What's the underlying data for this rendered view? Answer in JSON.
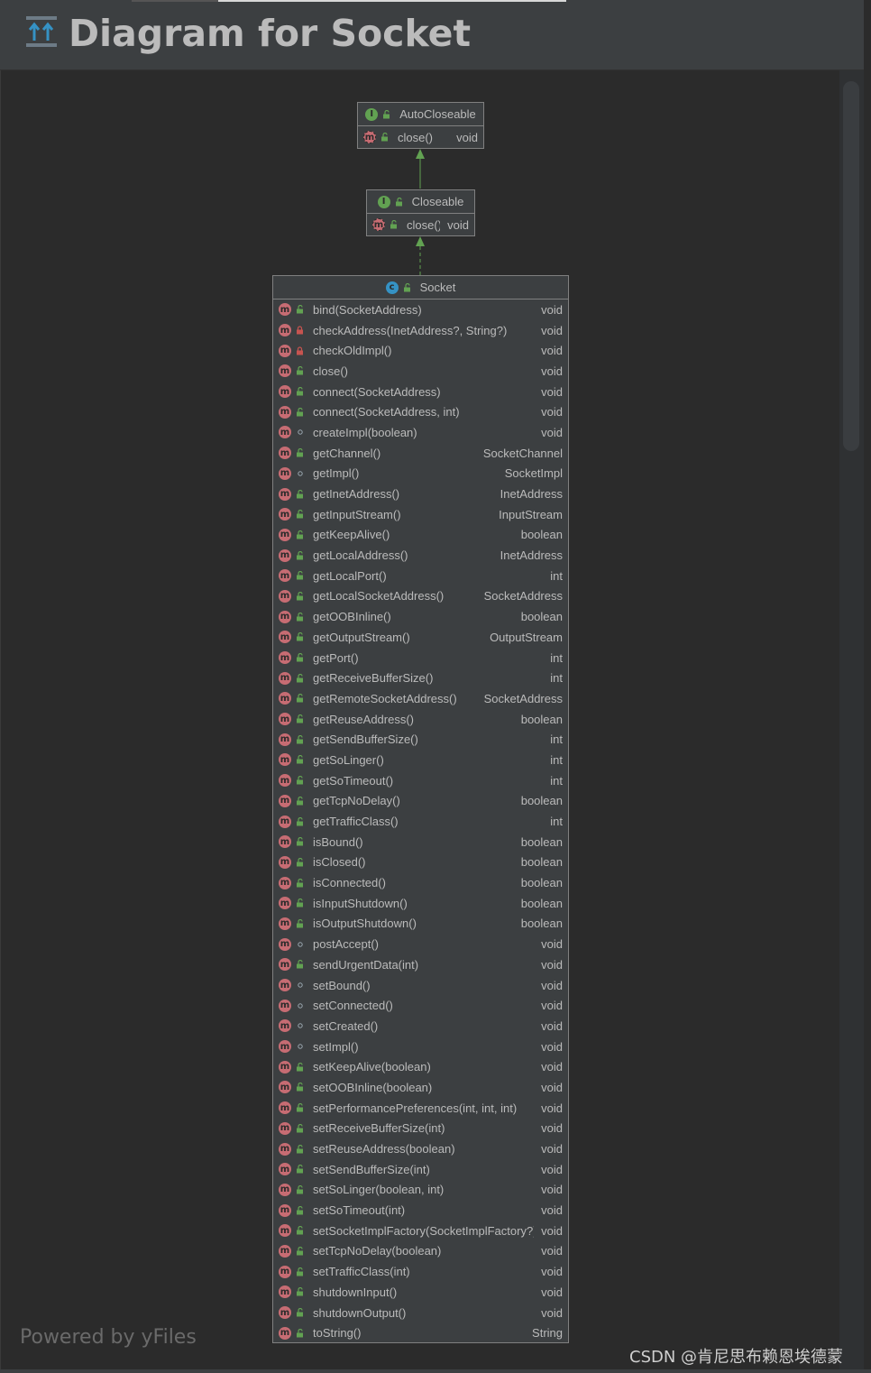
{
  "title": "Diagram for Socket",
  "footer": {
    "powered_by": "Powered by yFiles",
    "watermark": "CSDN @肯尼思布赖恩埃德蒙"
  },
  "colors": {
    "background": "#2b2b2b",
    "node_fill": "#3c3f41",
    "node_border": "#808080",
    "method_badge": "#c76c73",
    "interface_badge": "#62a252",
    "class_badge": "#3592c4",
    "public_lock": "#62a252",
    "private_lock": "#c75450",
    "arrow": "#62a252"
  },
  "nodes": {
    "autocloseable": {
      "name": "AutoCloseable",
      "kind": "interface",
      "methods": [
        {
          "name": "close()",
          "type": "void",
          "visibility": "public",
          "abstract": true
        }
      ]
    },
    "closeable": {
      "name": "Closeable",
      "kind": "interface",
      "methods": [
        {
          "name": "close()",
          "type": "void",
          "visibility": "public",
          "abstract": true
        }
      ]
    },
    "socket": {
      "name": "Socket",
      "kind": "class",
      "methods": [
        {
          "name": "bind(SocketAddress)",
          "type": "void",
          "visibility": "public"
        },
        {
          "name": "checkAddress(InetAddress?, String?)",
          "type": "void",
          "visibility": "private"
        },
        {
          "name": "checkOldImpl()",
          "type": "void",
          "visibility": "private"
        },
        {
          "name": "close()",
          "type": "void",
          "visibility": "public"
        },
        {
          "name": "connect(SocketAddress)",
          "type": "void",
          "visibility": "public"
        },
        {
          "name": "connect(SocketAddress, int)",
          "type": "void",
          "visibility": "public"
        },
        {
          "name": "createImpl(boolean)",
          "type": "void",
          "visibility": "package"
        },
        {
          "name": "getChannel()",
          "type": "SocketChannel",
          "visibility": "public"
        },
        {
          "name": "getImpl()",
          "type": "SocketImpl",
          "visibility": "package"
        },
        {
          "name": "getInetAddress()",
          "type": "InetAddress",
          "visibility": "public"
        },
        {
          "name": "getInputStream()",
          "type": "InputStream",
          "visibility": "public"
        },
        {
          "name": "getKeepAlive()",
          "type": "boolean",
          "visibility": "public"
        },
        {
          "name": "getLocalAddress()",
          "type": "InetAddress",
          "visibility": "public"
        },
        {
          "name": "getLocalPort()",
          "type": "int",
          "visibility": "public"
        },
        {
          "name": "getLocalSocketAddress()",
          "type": "SocketAddress",
          "visibility": "public"
        },
        {
          "name": "getOOBInline()",
          "type": "boolean",
          "visibility": "public"
        },
        {
          "name": "getOutputStream()",
          "type": "OutputStream",
          "visibility": "public"
        },
        {
          "name": "getPort()",
          "type": "int",
          "visibility": "public"
        },
        {
          "name": "getReceiveBufferSize()",
          "type": "int",
          "visibility": "public"
        },
        {
          "name": "getRemoteSocketAddress()",
          "type": "SocketAddress",
          "visibility": "public"
        },
        {
          "name": "getReuseAddress()",
          "type": "boolean",
          "visibility": "public"
        },
        {
          "name": "getSendBufferSize()",
          "type": "int",
          "visibility": "public"
        },
        {
          "name": "getSoLinger()",
          "type": "int",
          "visibility": "public"
        },
        {
          "name": "getSoTimeout()",
          "type": "int",
          "visibility": "public"
        },
        {
          "name": "getTcpNoDelay()",
          "type": "boolean",
          "visibility": "public"
        },
        {
          "name": "getTrafficClass()",
          "type": "int",
          "visibility": "public"
        },
        {
          "name": "isBound()",
          "type": "boolean",
          "visibility": "public"
        },
        {
          "name": "isClosed()",
          "type": "boolean",
          "visibility": "public"
        },
        {
          "name": "isConnected()",
          "type": "boolean",
          "visibility": "public"
        },
        {
          "name": "isInputShutdown()",
          "type": "boolean",
          "visibility": "public"
        },
        {
          "name": "isOutputShutdown()",
          "type": "boolean",
          "visibility": "public"
        },
        {
          "name": "postAccept()",
          "type": "void",
          "visibility": "package"
        },
        {
          "name": "sendUrgentData(int)",
          "type": "void",
          "visibility": "public"
        },
        {
          "name": "setBound()",
          "type": "void",
          "visibility": "package"
        },
        {
          "name": "setConnected()",
          "type": "void",
          "visibility": "package"
        },
        {
          "name": "setCreated()",
          "type": "void",
          "visibility": "package"
        },
        {
          "name": "setImpl()",
          "type": "void",
          "visibility": "package"
        },
        {
          "name": "setKeepAlive(boolean)",
          "type": "void",
          "visibility": "public"
        },
        {
          "name": "setOOBInline(boolean)",
          "type": "void",
          "visibility": "public"
        },
        {
          "name": "setPerformancePreferences(int, int, int)",
          "type": "void",
          "visibility": "public"
        },
        {
          "name": "setReceiveBufferSize(int)",
          "type": "void",
          "visibility": "public"
        },
        {
          "name": "setReuseAddress(boolean)",
          "type": "void",
          "visibility": "public"
        },
        {
          "name": "setSendBufferSize(int)",
          "type": "void",
          "visibility": "public"
        },
        {
          "name": "setSoLinger(boolean, int)",
          "type": "void",
          "visibility": "public"
        },
        {
          "name": "setSoTimeout(int)",
          "type": "void",
          "visibility": "public"
        },
        {
          "name": "setSocketImplFactory(SocketImplFactory?)",
          "type": "void",
          "visibility": "public"
        },
        {
          "name": "setTcpNoDelay(boolean)",
          "type": "void",
          "visibility": "public"
        },
        {
          "name": "setTrafficClass(int)",
          "type": "void",
          "visibility": "public"
        },
        {
          "name": "shutdownInput()",
          "type": "void",
          "visibility": "public"
        },
        {
          "name": "shutdownOutput()",
          "type": "void",
          "visibility": "public"
        },
        {
          "name": "toString()",
          "type": "String",
          "visibility": "public"
        }
      ]
    }
  }
}
